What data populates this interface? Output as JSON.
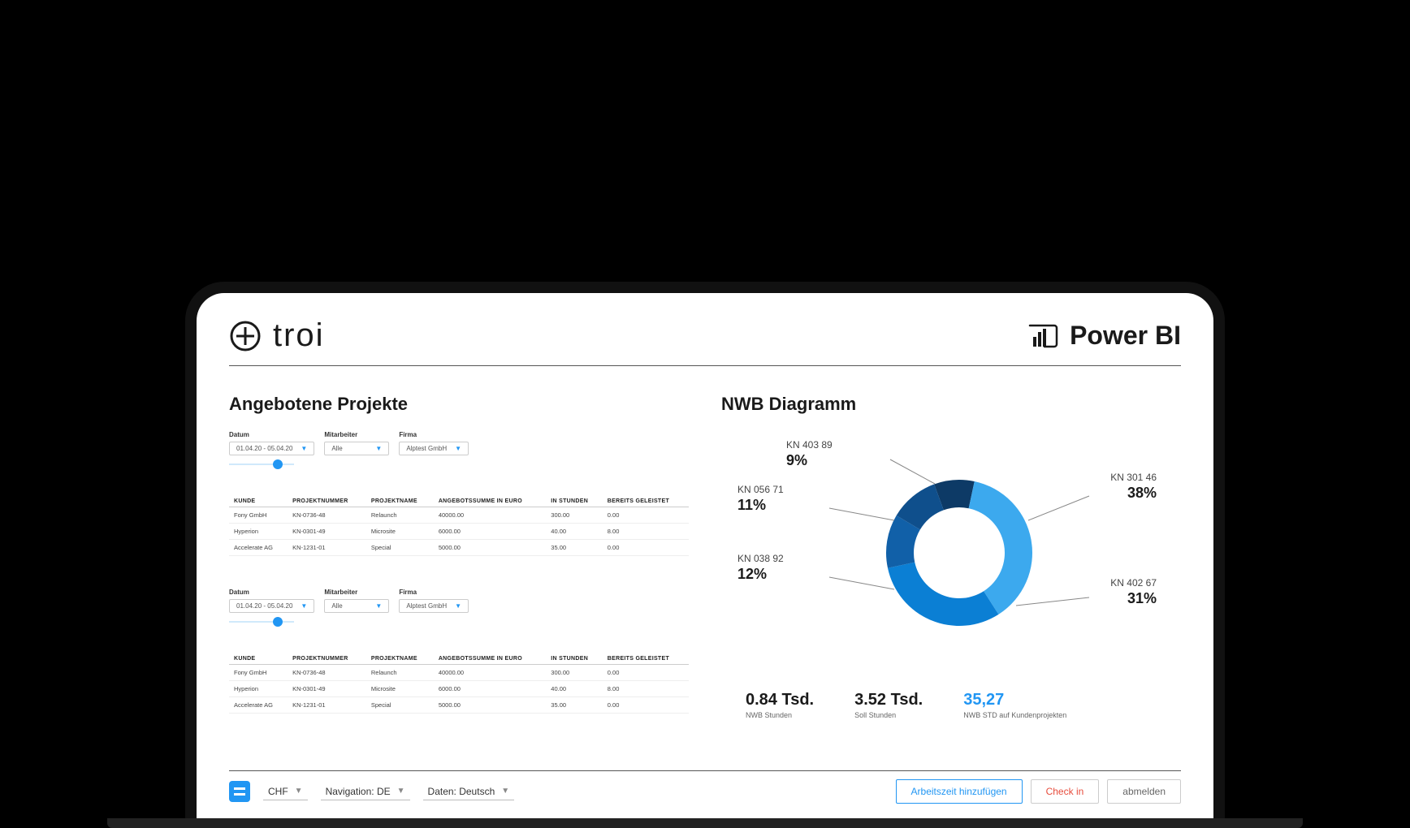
{
  "header": {
    "logo_troi": "troi",
    "logo_powerbi": "Power BI"
  },
  "left": {
    "title": "Angebotene Projekte",
    "filter_labels": {
      "date": "Datum",
      "employee": "Mitarbeiter",
      "company": "Firma"
    },
    "filters": {
      "date": "01.04.20 - 05.04.20",
      "employee": "Alle",
      "company": "Alptest GmbH"
    },
    "columns": [
      "KUNDE",
      "PROJEKTNUMMER",
      "PROJEKTNAME",
      "ANGEBOTSSUMME IN EURO",
      "IN STUNDEN",
      "BEREITS GELEISTET"
    ],
    "rows": [
      {
        "c0": "Fony GmbH",
        "c1": "KN-0736-48",
        "c2": "Relaunch",
        "c3": "40000.00",
        "c4": "300.00",
        "c5": "0.00"
      },
      {
        "c0": "Hyperion",
        "c1": "KN-0301-49",
        "c2": "Microsite",
        "c3": "6000.00",
        "c4": "40.00",
        "c5": "8.00"
      },
      {
        "c0": "Accelerate AG",
        "c1": "KN-1231-01",
        "c2": "Special",
        "c3": "5000.00",
        "c4": "35.00",
        "c5": "0.00"
      }
    ]
  },
  "right": {
    "title": "NWB Diagramm",
    "metrics": [
      {
        "val": "0.84 Tsd.",
        "label": "NWB Stunden"
      },
      {
        "val": "3.52 Tsd.",
        "label": "Soll Stunden"
      },
      {
        "val": "35,27",
        "label": "NWB STD auf Kundenprojekten",
        "blue": true
      }
    ]
  },
  "chart_data": {
    "type": "pie",
    "title": "NWB Diagramm",
    "series": [
      {
        "name": "KN 403 89",
        "value": 9,
        "color": "#0d3a66"
      },
      {
        "name": "KN 301 46",
        "value": 38,
        "color": "#3ca9ee"
      },
      {
        "name": "KN 402 67",
        "value": 31,
        "color": "#0b7fd4"
      },
      {
        "name": "KN 038 92",
        "value": 12,
        "color": "#1160a8"
      },
      {
        "name": "KN 056 71",
        "value": 11,
        "color": "#0f4f8c"
      }
    ]
  },
  "footer": {
    "currency": "CHF",
    "nav": "Navigation: DE",
    "data": "Daten: Deutsch",
    "btn_add": "Arbeitszeit hinzufügen",
    "btn_checkin": "Check in",
    "btn_logout": "abmelden"
  }
}
